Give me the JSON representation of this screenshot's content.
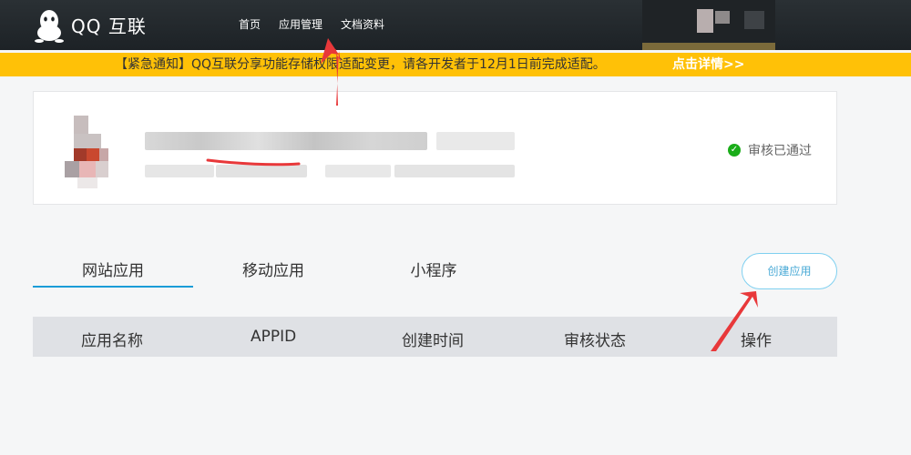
{
  "header": {
    "brand": "QQ 互联",
    "nav": [
      "首页",
      "应用管理",
      "文档资料"
    ]
  },
  "notice": {
    "text": "【紧急通知】QQ互联分享功能存储权限适配变更，请各开发者于12月1日前完成适配。",
    "link": "点击详情>>"
  },
  "developer_card": {
    "status": "审核已通过"
  },
  "tabs": [
    "网站应用",
    "移动应用",
    "小程序"
  ],
  "create_button": "创建应用",
  "table": {
    "columns": [
      "应用名称",
      "APPID",
      "创建时间",
      "审核状态",
      "操作"
    ]
  },
  "colors": {
    "nav_bg": "#1d2226",
    "notice_bg": "#ffc107",
    "tab_active": "#1a9cd8",
    "status_check": "#1aad19",
    "annotation_arrow": "#e8383a"
  }
}
